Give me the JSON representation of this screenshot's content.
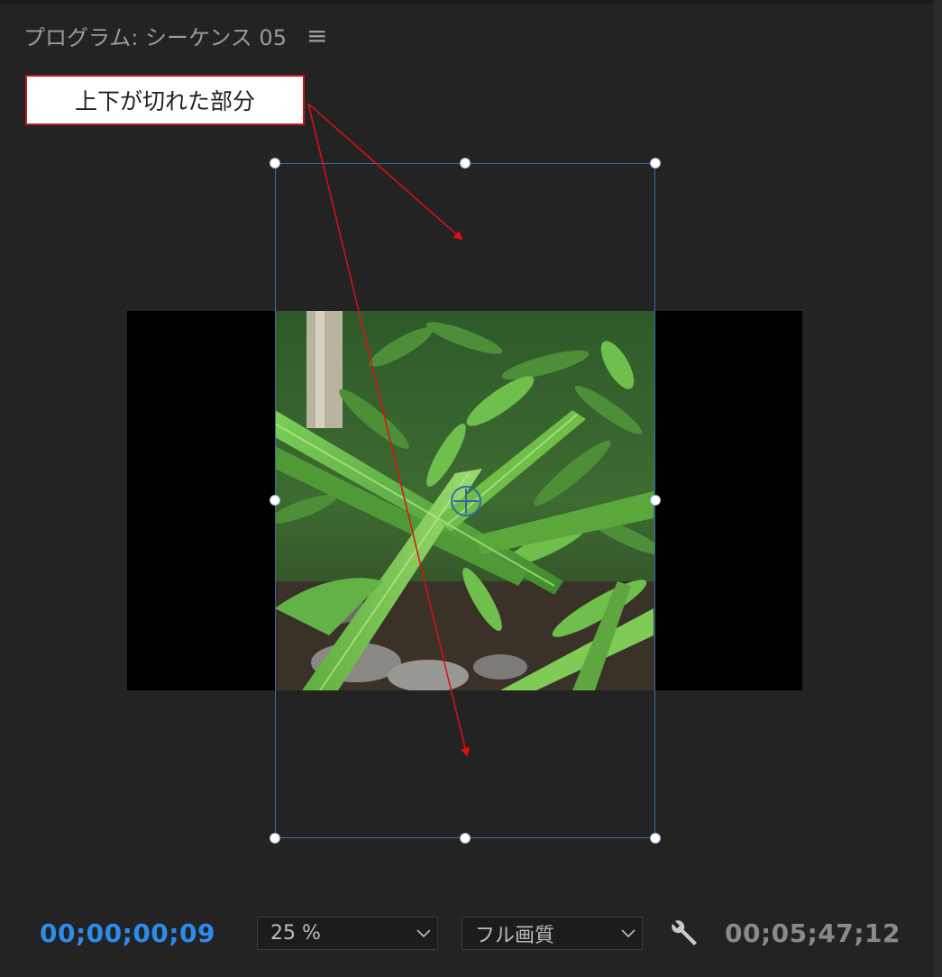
{
  "panel": {
    "title": "プログラム: シーケンス 05",
    "menu_icon": "hamburger-menu-icon"
  },
  "annotation": {
    "callout_text": "上下が切れた部分",
    "border_color": "#c8161d",
    "arrow_color": "#e01010"
  },
  "monitor": {
    "frame_color": "#000000",
    "bbox_color": "#3b6fa8",
    "clip_content": "green leaves foliage photo"
  },
  "controls": {
    "current_timecode": "00;00;00;09",
    "zoom_value": "25 %",
    "quality_value": "フル画質",
    "settings_icon": "wrench-icon",
    "duration_timecode": "00;05;47;12"
  },
  "colors": {
    "background": "#232323",
    "accent_timecode": "#2d8ceb"
  }
}
